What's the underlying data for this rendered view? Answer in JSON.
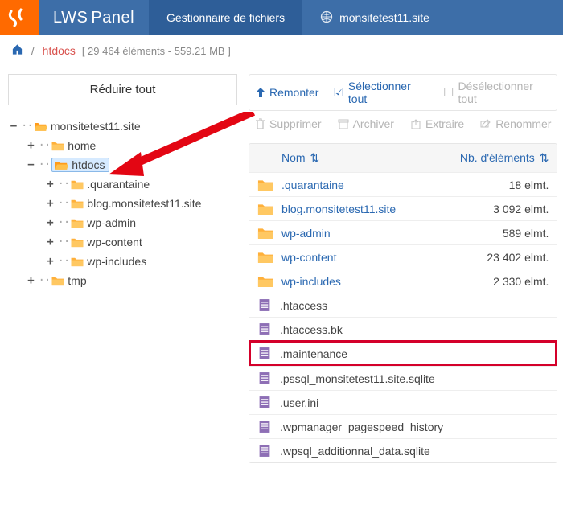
{
  "header": {
    "brand_left": "LWS",
    "brand_right": "Panel",
    "tab1": "Gestionnaire de fichiers",
    "tab2": "monsitetest11.site"
  },
  "breadcrumb": {
    "current": "htdocs",
    "meta": "[ 29 464 éléments - 559.21 MB ]"
  },
  "side": {
    "collapse": "Réduire tout",
    "tree_root": "monsitetest11.site",
    "tree_home": "home",
    "tree_htdocs": "htdocs",
    "tree_quarantaine": ".quarantaine",
    "tree_blog": "blog.monsitetest11.site",
    "tree_wpadmin": "wp-admin",
    "tree_wpcontent": "wp-content",
    "tree_wpincludes": "wp-includes",
    "tree_tmp": "tmp"
  },
  "toolbar": {
    "up": "Remonter",
    "select_all": "Sélectionner tout",
    "deselect": "Désélectionner tout",
    "delete": "Supprimer",
    "archive": "Archiver",
    "extract": "Extraire",
    "rename": "Renommer"
  },
  "table": {
    "col_name": "Nom",
    "col_count": "Nb. d'éléments",
    "rows": [
      {
        "name": ".quarantaine",
        "type": "folder",
        "count": "18 elmt."
      },
      {
        "name": "blog.monsitetest11.site",
        "type": "folder",
        "count": "3 092 elmt."
      },
      {
        "name": "wp-admin",
        "type": "folder",
        "count": "589 elmt."
      },
      {
        "name": "wp-content",
        "type": "folder",
        "count": "23 402 elmt."
      },
      {
        "name": "wp-includes",
        "type": "folder",
        "count": "2 330 elmt."
      },
      {
        "name": ".htaccess",
        "type": "file",
        "count": ""
      },
      {
        "name": ".htaccess.bk",
        "type": "file",
        "count": ""
      },
      {
        "name": ".maintenance",
        "type": "file",
        "count": "",
        "hl": true
      },
      {
        "name": ".pssql_monsitetest11.site.sqlite",
        "type": "file",
        "count": ""
      },
      {
        "name": ".user.ini",
        "type": "file",
        "count": ""
      },
      {
        "name": ".wpmanager_pagespeed_history",
        "type": "file",
        "count": ""
      },
      {
        "name": ".wpsql_additionnal_data.sqlite",
        "type": "file",
        "count": ""
      }
    ]
  }
}
